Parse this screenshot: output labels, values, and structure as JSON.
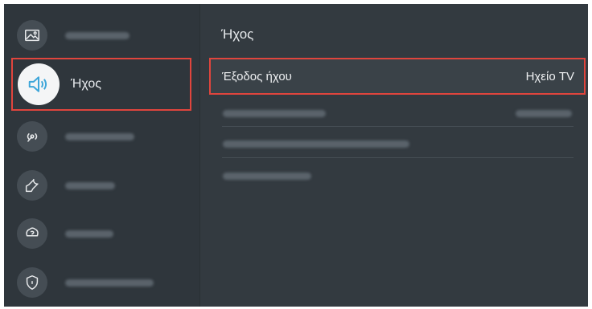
{
  "sidebar": {
    "items": [
      {
        "icon": "picture-icon",
        "label": "",
        "blurred": true
      },
      {
        "icon": "sound-icon",
        "label": "Ήχος",
        "blurred": false
      },
      {
        "icon": "broadcast-icon",
        "label": "",
        "blurred": true
      },
      {
        "icon": "wrench-icon",
        "label": "",
        "blurred": true
      },
      {
        "icon": "support-icon",
        "label": "",
        "blurred": true
      },
      {
        "icon": "shield-icon",
        "label": "",
        "blurred": true
      }
    ]
  },
  "main": {
    "title": "Ήχος",
    "rows": [
      {
        "label": "Έξοδος ήχου",
        "value": "Ηχείο TV",
        "focused": true
      },
      {
        "label": "",
        "value": "",
        "blurred": true
      },
      {
        "label": "",
        "value": "",
        "blurred": true
      },
      {
        "label": "",
        "value": "",
        "blurred": true
      }
    ]
  },
  "colors": {
    "highlight": "#e0453d",
    "background": "#333a40",
    "sidebar": "#2f363c"
  }
}
